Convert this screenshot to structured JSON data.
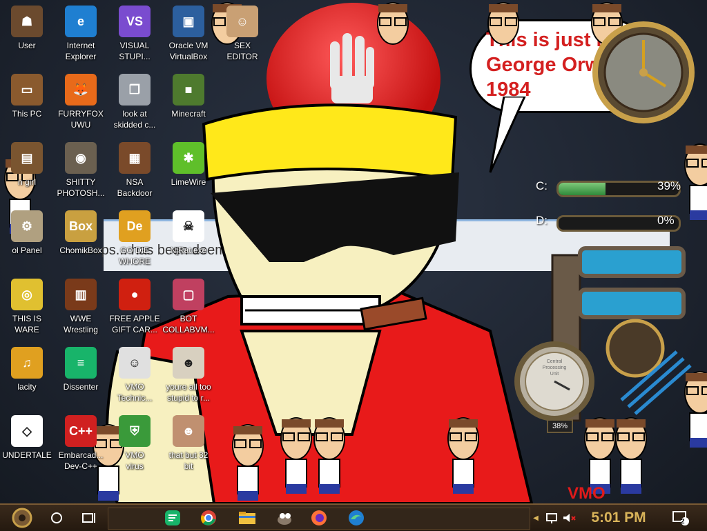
{
  "desktop_icons": [
    {
      "label": "User",
      "icon": "user-icon",
      "color": "#6b4a2e"
    },
    {
      "label": "Internet\nExplorer",
      "icon": "edge-icon",
      "color": "#1f7fd1"
    },
    {
      "label": "VISUAL\nSTUPI...",
      "icon": "visual-studio-icon",
      "color": "#7a4ccf"
    },
    {
      "label": "Oracle VM\nVirtualBox",
      "icon": "virtualbox-icon",
      "color": "#2c5f9e"
    },
    {
      "label": "SEX\nEDITOR",
      "icon": "hank-icon",
      "color": "#c9a074"
    },
    {
      "label": "This PC",
      "icon": "computer-icon",
      "color": "#8a5a2e"
    },
    {
      "label": "FURRYFOX\nUWU",
      "icon": "firefox-icon",
      "color": "#e86a1a"
    },
    {
      "label": "look at\nskidded c...",
      "icon": "folder-stack-icon",
      "color": "#9aa0a8"
    },
    {
      "label": "Minecraft",
      "icon": "minecraft-icon",
      "color": "#4e7a2e"
    },
    {
      "label": "n girl",
      "icon": "book-icon",
      "color": "#7a5530"
    },
    {
      "label": "SHITTY\nPHOTOSH...",
      "icon": "gimp-icon",
      "color": "#6b6050"
    },
    {
      "label": "NSA\nBackdoor",
      "icon": "box-icon",
      "color": "#7a4a2a"
    },
    {
      "label": "LimeWire",
      "icon": "limewire-icon",
      "color": "#5fbf2a"
    },
    {
      "label": "ol Panel",
      "icon": "control-panel-icon",
      "color": "#b0a080"
    },
    {
      "label": "ChomikBox",
      "icon": "hamster-icon",
      "color": "#c9a040"
    },
    {
      "label": "GO DIE\nWHORE",
      "icon": "de-icon",
      "color": "#e0a020"
    },
    {
      "label": "NjRat.exe",
      "icon": "skull-icon",
      "color": "#ffffff"
    },
    {
      "label": "THIS IS\nWARE",
      "icon": "chrome-icon",
      "color": "#e0c030"
    },
    {
      "label": "WWE\nWrestling",
      "icon": "wrestling-icon",
      "color": "#7a3a1a"
    },
    {
      "label": "FREE APPLE\nGIFT CAR...",
      "icon": "apple-icon",
      "color": "#d02010"
    },
    {
      "label": "BOT\nCOLLABVM...",
      "icon": "monitor-icon",
      "color": "#c04060"
    },
    {
      "label": "lacity",
      "icon": "audacity-icon",
      "color": "#e0a020"
    },
    {
      "label": "Dissenter",
      "icon": "dissenter-icon",
      "color": "#18b46a"
    },
    {
      "label": "VMO\nTechnic...",
      "icon": "doctor-icon",
      "color": "#e0e0e0"
    },
    {
      "label": "youre all too\nstupid to r...",
      "icon": "portrait-icon",
      "color": "#d8d0c0"
    },
    {
      "label": "UNDERTALE",
      "icon": "unity-icon",
      "color": "#ffffff"
    },
    {
      "label": "Embarcad...\nDev-C++",
      "icon": "devcpp-icon",
      "color": "#d02020"
    },
    {
      "label": "VMO\nvirus",
      "icon": "shield-icon",
      "color": "#3a9a3a"
    },
    {
      "label": "that but 32\nbit",
      "icon": "portrait-icon",
      "color": "#c09070"
    }
  ],
  "wallpaper": {
    "speech_bubble": "This is just like\nGeorge Orwells\n1984",
    "background_text": "Oops... has been deemed inap",
    "watermark": "VMO"
  },
  "gadgets": {
    "drives": [
      {
        "label": "C:",
        "percent_text": "39%",
        "used": 0.39
      },
      {
        "label": "D:",
        "percent_text": "0%",
        "used": 0.0
      }
    ],
    "cpu_gauge_text": "38%",
    "gauge_label": "Central\nProcessing\nUnit"
  },
  "taskbar": {
    "time": "5:01 PM",
    "notification_count": "2",
    "apps": [
      "dissenter-icon",
      "chrome-icon",
      "file-explorer-icon",
      "gimp-icon",
      "firefox-icon",
      "edge-icon"
    ]
  },
  "colors": {
    "taskbar": "#2a1d12",
    "clock_text": "#d9b45a",
    "bubble_text": "#d42020"
  }
}
